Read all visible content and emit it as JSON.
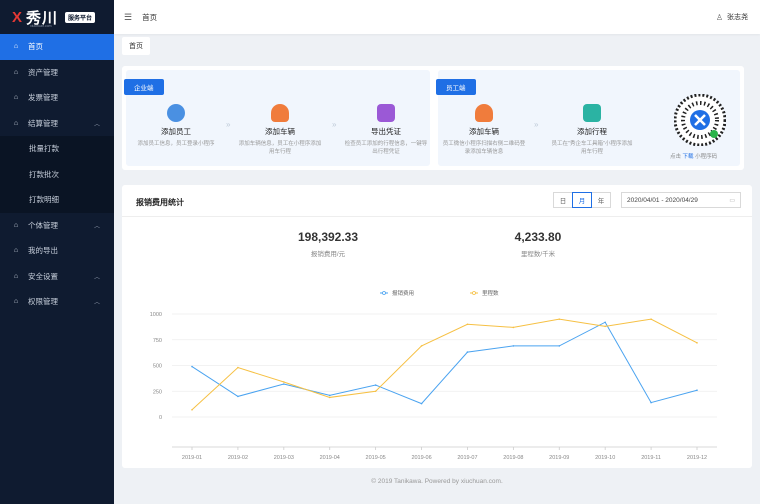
{
  "brand": {
    "logo_mark": "X",
    "name": "秀川",
    "sub": "xiuchuan.com",
    "badge": "服务平台"
  },
  "sidebar": {
    "items": [
      {
        "label": "首页",
        "icon": "home-icon"
      },
      {
        "label": "资产管理",
        "icon": "home-icon"
      },
      {
        "label": "发票管理",
        "icon": "home-icon"
      },
      {
        "label": "结算管理",
        "icon": "home-icon"
      },
      {
        "label": "个体管理",
        "icon": "home-icon"
      },
      {
        "label": "我的导出",
        "icon": "home-icon"
      },
      {
        "label": "安全设置",
        "icon": "home-icon"
      },
      {
        "label": "权限管理",
        "icon": "home-icon"
      }
    ],
    "sub_items": [
      "批量打款",
      "打款批次",
      "打款明细"
    ]
  },
  "topbar": {
    "breadcrumb": "首页",
    "user": "张志尧"
  },
  "tab": "首页",
  "quick": {
    "enterprise": {
      "tag": "企业端",
      "items": [
        {
          "title": "添加员工",
          "desc": "添加员工信息，员工登录小程序"
        },
        {
          "title": "添加车辆",
          "desc": "添加车辆信息，员工在小程序添加用车行程"
        },
        {
          "title": "导出凭证",
          "desc": "检查员工添加的行程信息，一键导出行程凭证"
        }
      ]
    },
    "employee": {
      "tag": "员工端",
      "items": [
        {
          "title": "添加车辆",
          "desc": "员工微信小程序扫描右侧二维码登录添加车辆信息"
        },
        {
          "title": "添加行程",
          "desc": "员工在\"秀企车工具箱\"小程序添加用车行程"
        }
      ]
    },
    "qr_caption_pre": "点击",
    "qr_caption_link": "下载",
    "qr_caption_post": "小程序码"
  },
  "stats": {
    "title": "报销费用统计",
    "periods": [
      "日",
      "月",
      "年"
    ],
    "selected_period": "月",
    "date_range": "2020/04/01 - 2020/04/29",
    "kpi1_value": "198,392.33",
    "kpi1_label": "报销费用/元",
    "kpi2_value": "4,233.80",
    "kpi2_label": "里程数/千米"
  },
  "chart_data": {
    "type": "line",
    "categories": [
      "2019-01",
      "2019-02",
      "2019-03",
      "2019-04",
      "2019-05",
      "2019-06",
      "2019-07",
      "2019-08",
      "2019-09",
      "2019-10",
      "2019-11",
      "2019-12"
    ],
    "series": [
      {
        "name": "报销费用",
        "color": "#4aa3f0",
        "values": [
          490,
          200,
          320,
          210,
          310,
          130,
          630,
          690,
          690,
          920,
          140,
          260
        ]
      },
      {
        "name": "里程数",
        "color": "#f6c043",
        "values": [
          70,
          480,
          340,
          190,
          250,
          690,
          900,
          870,
          950,
          880,
          950,
          720
        ]
      }
    ],
    "ylim": [
      0,
      1000
    ],
    "yticks": [
      0,
      250,
      500,
      750,
      1000
    ],
    "grid": true,
    "legend": "top-center"
  },
  "footer": "© 2019 Tanikawa. Powered by xiuchuan.com."
}
